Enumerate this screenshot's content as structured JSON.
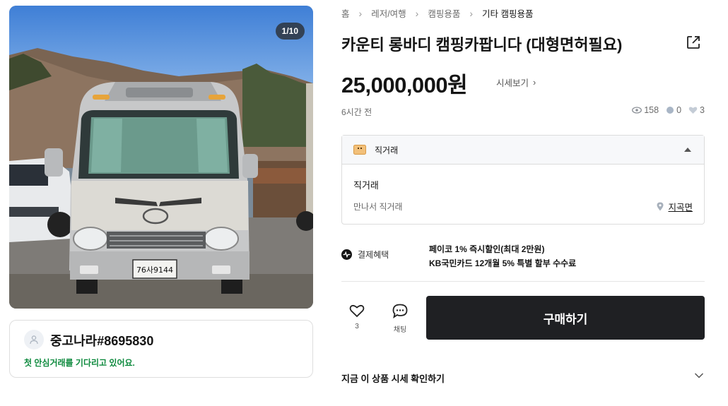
{
  "gallery": {
    "counter": "1/10",
    "plate_text": "76사9144"
  },
  "seller": {
    "name": "중고나라#8695830",
    "note": "첫 안심거래를 기다리고 있어요."
  },
  "breadcrumb": {
    "home": "홈",
    "level1": "레저/여행",
    "level2": "캠핑용품",
    "level3": "기타 캠핑용품"
  },
  "product": {
    "title": "카운티 롱바디 캠핑카팝니다 (대형면허필요)",
    "price": "25,000,000원",
    "market_link": "시세보기",
    "time_ago": "6시간 전",
    "views": "158",
    "chats": "0",
    "likes": "3"
  },
  "trade": {
    "header_label": "직거래",
    "type": "직거래",
    "description": "만나서 직거래",
    "location": "지곡면"
  },
  "payment": {
    "label": "결제혜택",
    "line1": "페이코 1% 즉시할인(최대 2만원)",
    "line2": "KB국민카드 12개월 5% 특별 할부 수수료"
  },
  "actions": {
    "like_count": "3",
    "chat_label": "채팅",
    "buy_label": "구매하기"
  },
  "market_check": {
    "label": "지금 이 상품 시세 확인하기"
  }
}
